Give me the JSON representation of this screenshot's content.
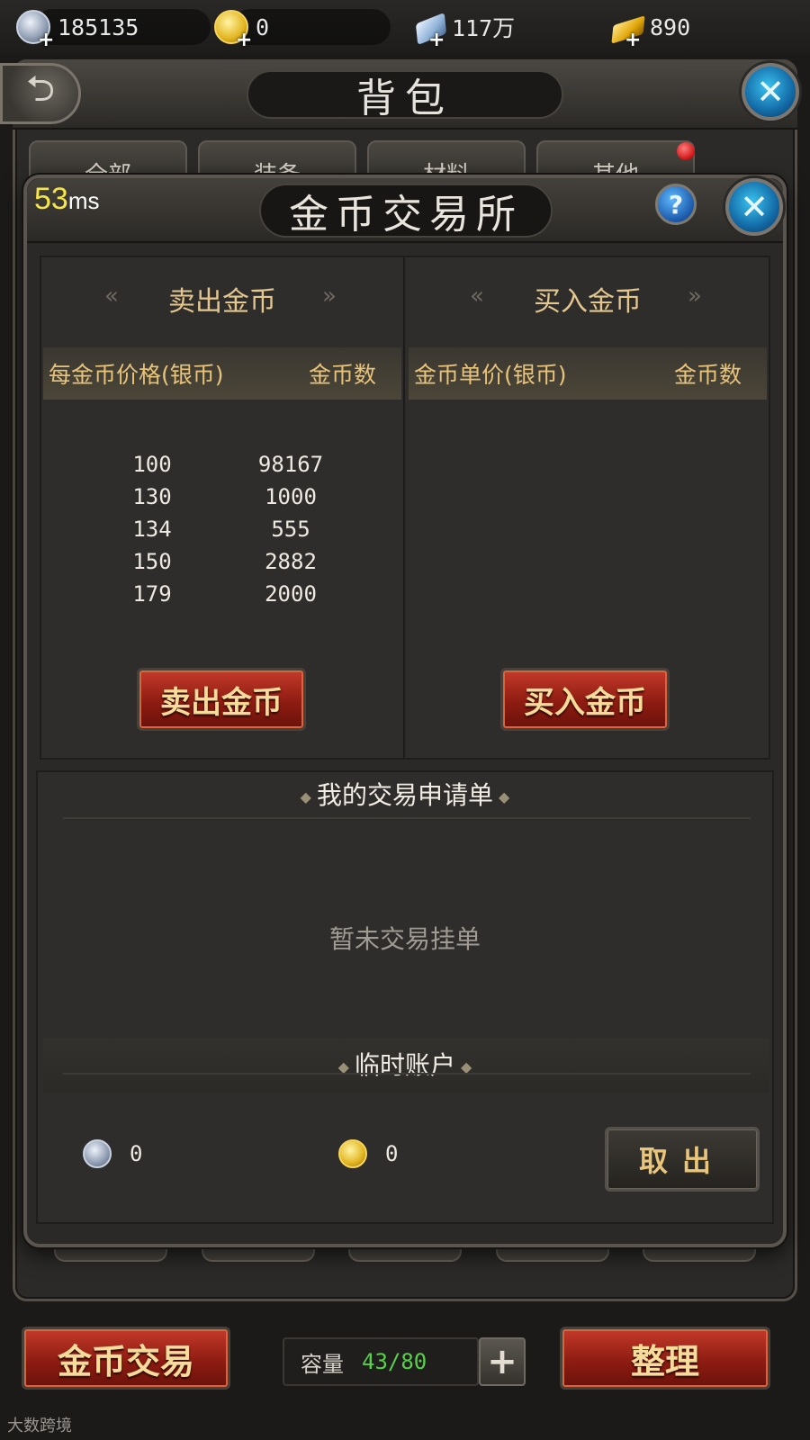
{
  "currencies": [
    {
      "icon": "silver-coin-icon",
      "value": "185135"
    },
    {
      "icon": "gold-coin-icon",
      "value": "0"
    },
    {
      "icon": "crystal-icon",
      "value": "117万"
    },
    {
      "icon": "gold-bar-icon",
      "value": "890"
    }
  ],
  "backpack": {
    "title": "背包",
    "tabs": [
      "全部",
      "装备",
      "材料",
      "其他"
    ],
    "capacity_label": "容量",
    "capacity_value": "43/80",
    "gold_trade_button": "金币交易",
    "sort_button": "整理"
  },
  "exchange": {
    "latency_number": "53",
    "latency_unit": "ms",
    "title": "金币交易所",
    "sell": {
      "title": "卖出金币",
      "price_header": "每金币价格(银币)",
      "qty_header": "金币数",
      "rows": [
        {
          "price": "100",
          "qty": "98167"
        },
        {
          "price": "130",
          "qty": "1000"
        },
        {
          "price": "134",
          "qty": "555"
        },
        {
          "price": "150",
          "qty": "2882"
        },
        {
          "price": "179",
          "qty": "2000"
        }
      ],
      "button": "卖出金币"
    },
    "buy": {
      "title": "买入金币",
      "price_header": "金币单价(银币)",
      "qty_header": "金币数",
      "rows": [],
      "button": "买入金币"
    },
    "my_orders": {
      "title": "我的交易申请单",
      "empty": "暂未交易挂单"
    },
    "temp_account": {
      "title": "临时账户",
      "silver": "0",
      "gold": "0",
      "withdraw_button": "取出"
    }
  },
  "watermark": "大数跨境",
  "colors": {
    "accent_gold": "#e3c78f",
    "capacity_green": "#58d14a",
    "button_red": "#8e1c12",
    "close_blue": "#1f6fb0"
  }
}
